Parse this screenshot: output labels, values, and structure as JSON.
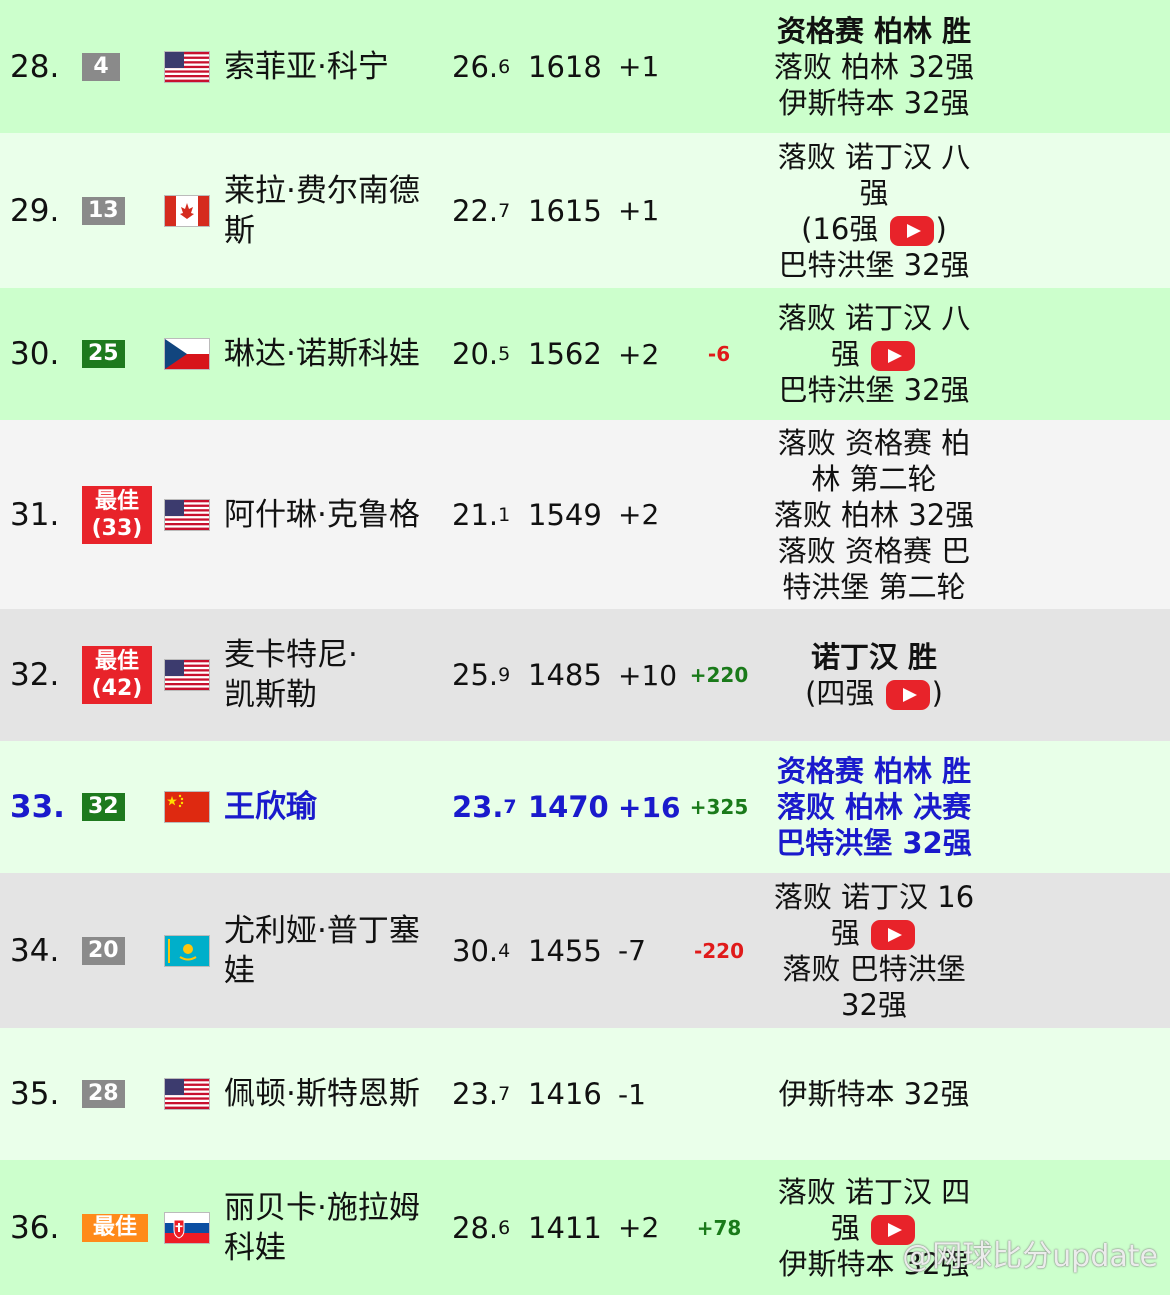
{
  "rows": [
    {
      "rank": "28.",
      "badge": "4",
      "badge_color": "gray",
      "flag": "us-flag",
      "name_lines": [
        "索菲亚·科宁"
      ],
      "age_main": "26.",
      "age_dec": "6",
      "points": "1618",
      "change": "+1",
      "delta": "",
      "result_lines": [
        "资格赛 柏林 胜",
        "落败 柏林 32强",
        "伊斯特本 32强"
      ]
    },
    {
      "rank": "29.",
      "badge": "13",
      "badge_color": "gray",
      "flag": "canada-flag",
      "name_lines": [
        "莱拉·费尔南德",
        "斯"
      ],
      "age_main": "22.",
      "age_dec": "7",
      "points": "1615",
      "change": "+1",
      "delta": "",
      "result_lines": [
        "落败 诺丁汉 八",
        "强",
        "(16强 ▶)",
        "巴特洪堡 32强"
      ]
    },
    {
      "rank": "30.",
      "badge": "25",
      "badge_color": "green",
      "flag": "czech-flag",
      "name_lines": [
        "琳达·诺斯科娃"
      ],
      "age_main": "20.",
      "age_dec": "5",
      "points": "1562",
      "change": "+2",
      "delta": "-6",
      "result_lines": [
        "落败 诺丁汉 八",
        "强 ▶",
        "巴特洪堡 32强"
      ]
    },
    {
      "rank": "31.",
      "badge": "最佳 (33)",
      "badge_color": "red",
      "flag": "us-flag",
      "name_lines": [
        "阿什琳·克鲁格"
      ],
      "age_main": "21.",
      "age_dec": "1",
      "points": "1549",
      "change": "+2",
      "delta": "",
      "result_lines": [
        "落败 资格赛 柏",
        "林 第二轮",
        "落败 柏林 32强",
        "落败 资格赛 巴",
        "特洪堡 第二轮"
      ]
    },
    {
      "rank": "32.",
      "badge": "最佳 (42)",
      "badge_color": "red",
      "flag": "us-flag",
      "name_lines": [
        "麦卡特尼·",
        "凯斯勒"
      ],
      "age_main": "25.",
      "age_dec": "9",
      "points": "1485",
      "change": "+10",
      "delta": "+220",
      "result_lines": [
        "诺丁汉 胜",
        "(四强 ▶)"
      ]
    },
    {
      "rank": "33.",
      "badge": "32",
      "badge_color": "green",
      "flag": "china-flag",
      "name_lines": [
        "王欣瑜"
      ],
      "age_main": "23.",
      "age_dec": "7",
      "points": "1470",
      "change": "+16",
      "delta": "+325",
      "result_lines": [
        "资格赛 柏林 胜",
        "落败 柏林 决赛",
        "巴特洪堡 32强"
      ]
    },
    {
      "rank": "34.",
      "badge": "20",
      "badge_color": "gray",
      "flag": "kazakhstan-flag",
      "name_lines": [
        "尤利娅·普丁塞",
        "娃"
      ],
      "age_main": "30.",
      "age_dec": "4",
      "points": "1455",
      "change": "-7",
      "delta": "-220",
      "result_lines": [
        "落败 诺丁汉 16",
        "强 ▶",
        "落败 巴特洪堡",
        "32强"
      ]
    },
    {
      "rank": "35.",
      "badge": "28",
      "badge_color": "gray",
      "flag": "us-flag",
      "name_lines": [
        "佩顿·斯特恩斯"
      ],
      "age_main": "23.",
      "age_dec": "7",
      "points": "1416",
      "change": "-1",
      "delta": "",
      "result_lines": [
        "伊斯特本 32强"
      ]
    },
    {
      "rank": "36.",
      "badge": "最佳",
      "badge_color": "orange",
      "flag": "slovakia-flag",
      "name_lines": [
        "丽贝卡·施拉姆",
        "科娃"
      ],
      "age_main": "28.",
      "age_dec": "6",
      "points": "1411",
      "change": "+2",
      "delta": "+78",
      "result_lines": [
        "落败 诺丁汉 四",
        "强 ▶",
        "伊斯特本 32强"
      ]
    }
  ],
  "watermark": "@网球比分update"
}
